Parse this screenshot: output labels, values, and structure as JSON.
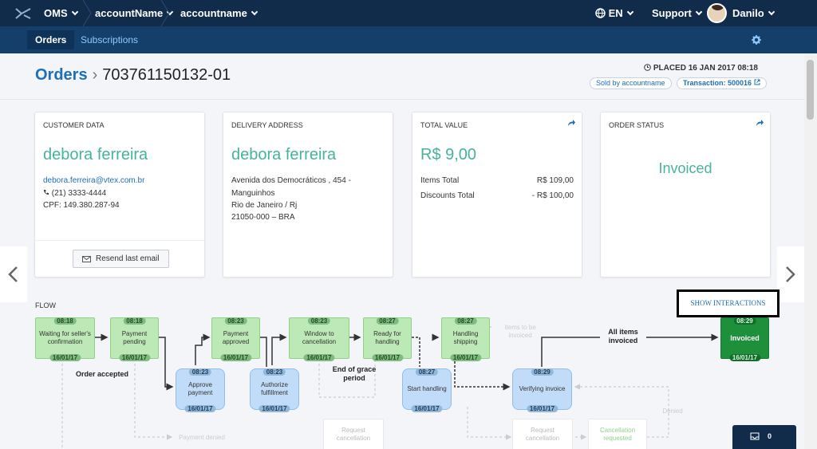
{
  "topbar": {
    "app": "OMS",
    "account_name": "accountName",
    "account_name2": "accountname",
    "language": "EN",
    "support": "Support",
    "user": "Danilo"
  },
  "subnav": {
    "tabs": [
      {
        "label": "Orders"
      },
      {
        "label": "Subscriptions"
      }
    ]
  },
  "header": {
    "breadcrumb": "Orders",
    "order_id": "703761150132-01",
    "placed": "PLACED 16 JAN 2017 08:18",
    "sold_by": "Sold by accountname",
    "transaction": "Transaction: 500016"
  },
  "customer": {
    "label": "CUSTOMER DATA",
    "name": "debora ferreira",
    "email": "debora.ferreira@vtex.com.br",
    "phone": "(21) 3333-4444",
    "cpf": "CPF: 149.380.287-94",
    "resend": "Resend last email"
  },
  "delivery": {
    "label": "DELIVERY ADDRESS",
    "name": "debora ferreira",
    "line1": "Avenida dos Democráticos , 454  -",
    "line2": "Manguinhos",
    "line3": "Rio de Janeiro / Rj",
    "line4": "21050-000 – BRA"
  },
  "total": {
    "label": "TOTAL VALUE",
    "value": "R$ 9,00",
    "items_label": "Items Total",
    "items_value": "R$ 109,00",
    "discounts_label": "Discounts Total",
    "discounts_value": "- R$ 100,00"
  },
  "status": {
    "label": "ORDER STATUS",
    "value": "Invoiced"
  },
  "flow": {
    "label": "FLOW",
    "show_interactions": "SHOW INTERACTIONS",
    "nodes": [
      {
        "time": "08:18",
        "name": "Waiting for seller's confirmation",
        "date": "16/01/17"
      },
      {
        "time": "08:18",
        "name": "Payment pending",
        "date": "16/01/17"
      },
      {
        "time": "08:23",
        "name": "Approve payment",
        "date": "16/01/17"
      },
      {
        "time": "08:23",
        "name": "Payment approved",
        "date": "16/01/17"
      },
      {
        "time": "08:23",
        "name": "Authorize fulfillment",
        "date": "16/01/17"
      },
      {
        "time": "08:23",
        "name": "Window to cancellation",
        "date": "16/01/17"
      },
      {
        "time": "08:27",
        "name": "Ready for handling",
        "date": "16/01/17"
      },
      {
        "time": "08:27",
        "name": "Start handling",
        "date": "16/01/17"
      },
      {
        "time": "08:27",
        "name": "Handling shipping",
        "date": "16/01/17"
      },
      {
        "time": "08:29",
        "name": "Verifying invoice",
        "date": "16/01/17"
      },
      {
        "time": "08:29",
        "name": "Invoiced",
        "date": "16/01/17"
      }
    ],
    "order_accepted": "Order accepted",
    "end_grace": "End of grace period",
    "all_items": "All items invoiced",
    "items_to_be": "Items to be invoiced",
    "payment_denied": "Payment denied",
    "request_cancel": "Request cancellation",
    "request_cancel2": "Request cancellation",
    "cancel_requested": "Cancellation requested",
    "denied": "Denied"
  },
  "chat": {
    "count": "0"
  }
}
